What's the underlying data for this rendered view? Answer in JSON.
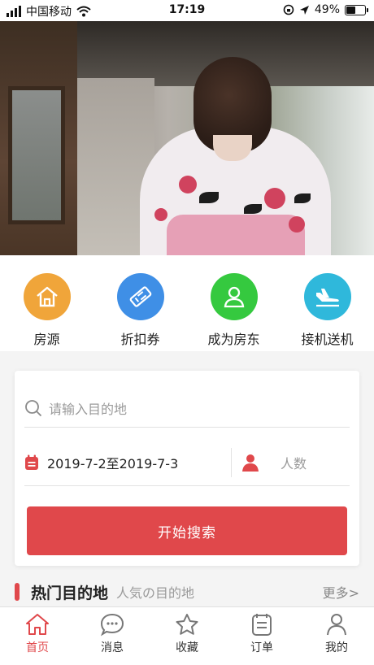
{
  "status_bar": {
    "carrier": "中国移动",
    "time": "17:19",
    "battery": "49%",
    "battery_level": 0.49
  },
  "banner": {
    "slide_count": 6,
    "active_index": 5
  },
  "quick_menu": [
    {
      "label": "房源",
      "icon": "house-icon",
      "color": "#f0a53a"
    },
    {
      "label": "折扣券",
      "icon": "ticket-icon",
      "color": "#3f8fe6"
    },
    {
      "label": "成为房东",
      "icon": "person-icon",
      "color": "#35c93f"
    },
    {
      "label": "接机送机",
      "icon": "plane-icon",
      "color": "#2fb8db"
    }
  ],
  "search": {
    "destination_placeholder": "请输入目的地",
    "dates": "2019-7-2至2019-7-3",
    "people_placeholder": "人数",
    "button_label": "开始搜索"
  },
  "hot_section": {
    "title": "热门目的地",
    "subtitle": "人気の目的地",
    "more": "更多>"
  },
  "tabs": [
    {
      "label": "首页",
      "icon": "home-icon",
      "active": true
    },
    {
      "label": "消息",
      "icon": "message-icon",
      "active": false
    },
    {
      "label": "收藏",
      "icon": "star-icon",
      "active": false
    },
    {
      "label": "订单",
      "icon": "order-icon",
      "active": false
    },
    {
      "label": "我的",
      "icon": "user-icon",
      "active": false
    }
  ],
  "colors": {
    "accent": "#e0484b",
    "active_dot": "#e0443d"
  }
}
